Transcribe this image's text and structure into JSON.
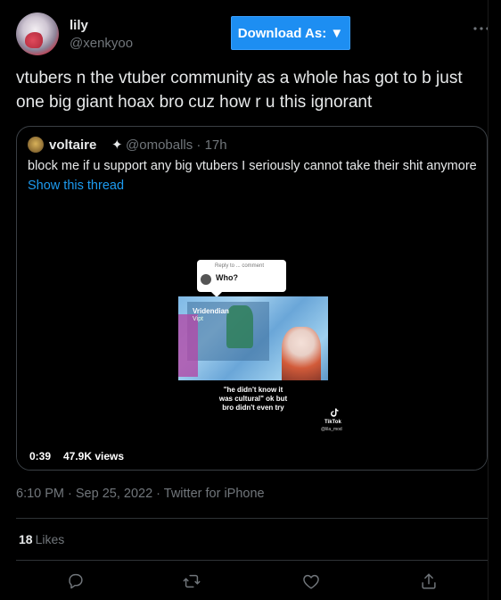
{
  "header": {
    "name": "lily",
    "handle": "@xenkyoo",
    "download_button": "Download As: ▼"
  },
  "tweet": {
    "text": "vtubers n the vtuber community as a whole has got to b just one big giant hoax bro cuz how r u this ignorant"
  },
  "quote": {
    "name": "voltaire",
    "verified_glyph": "✦",
    "handle_time": "@omoballs · 17h",
    "text": "block me if u support any big vtubers I seriously cannot take their shit anymore",
    "link": "Show this thread",
    "video": {
      "reply_small": "Reply to ... comment",
      "reply_who": "Who?",
      "frame_title": "Vridendian",
      "frame_sub": "Vipt",
      "caption": "\"he didn't know it was cultural\" ok but bro didn't even try",
      "tiktok_label": "TikTok",
      "tiktok_user": "@lila_mod",
      "duration": "0:39",
      "views": "47.9K views"
    }
  },
  "meta": {
    "timestamp": "6:10 PM · Sep 25, 2022 · Twitter for iPhone"
  },
  "stats": {
    "likes_count": "18",
    "likes_label": "Likes"
  },
  "actions": [
    "reply-icon",
    "retweet-icon",
    "like-icon",
    "share-icon"
  ],
  "colors": {
    "background": "#000000",
    "text": "#e7e9ea",
    "muted": "#71767b",
    "link": "#1d9bf0",
    "button": "#1d8ef2",
    "border": "#2f3336"
  }
}
